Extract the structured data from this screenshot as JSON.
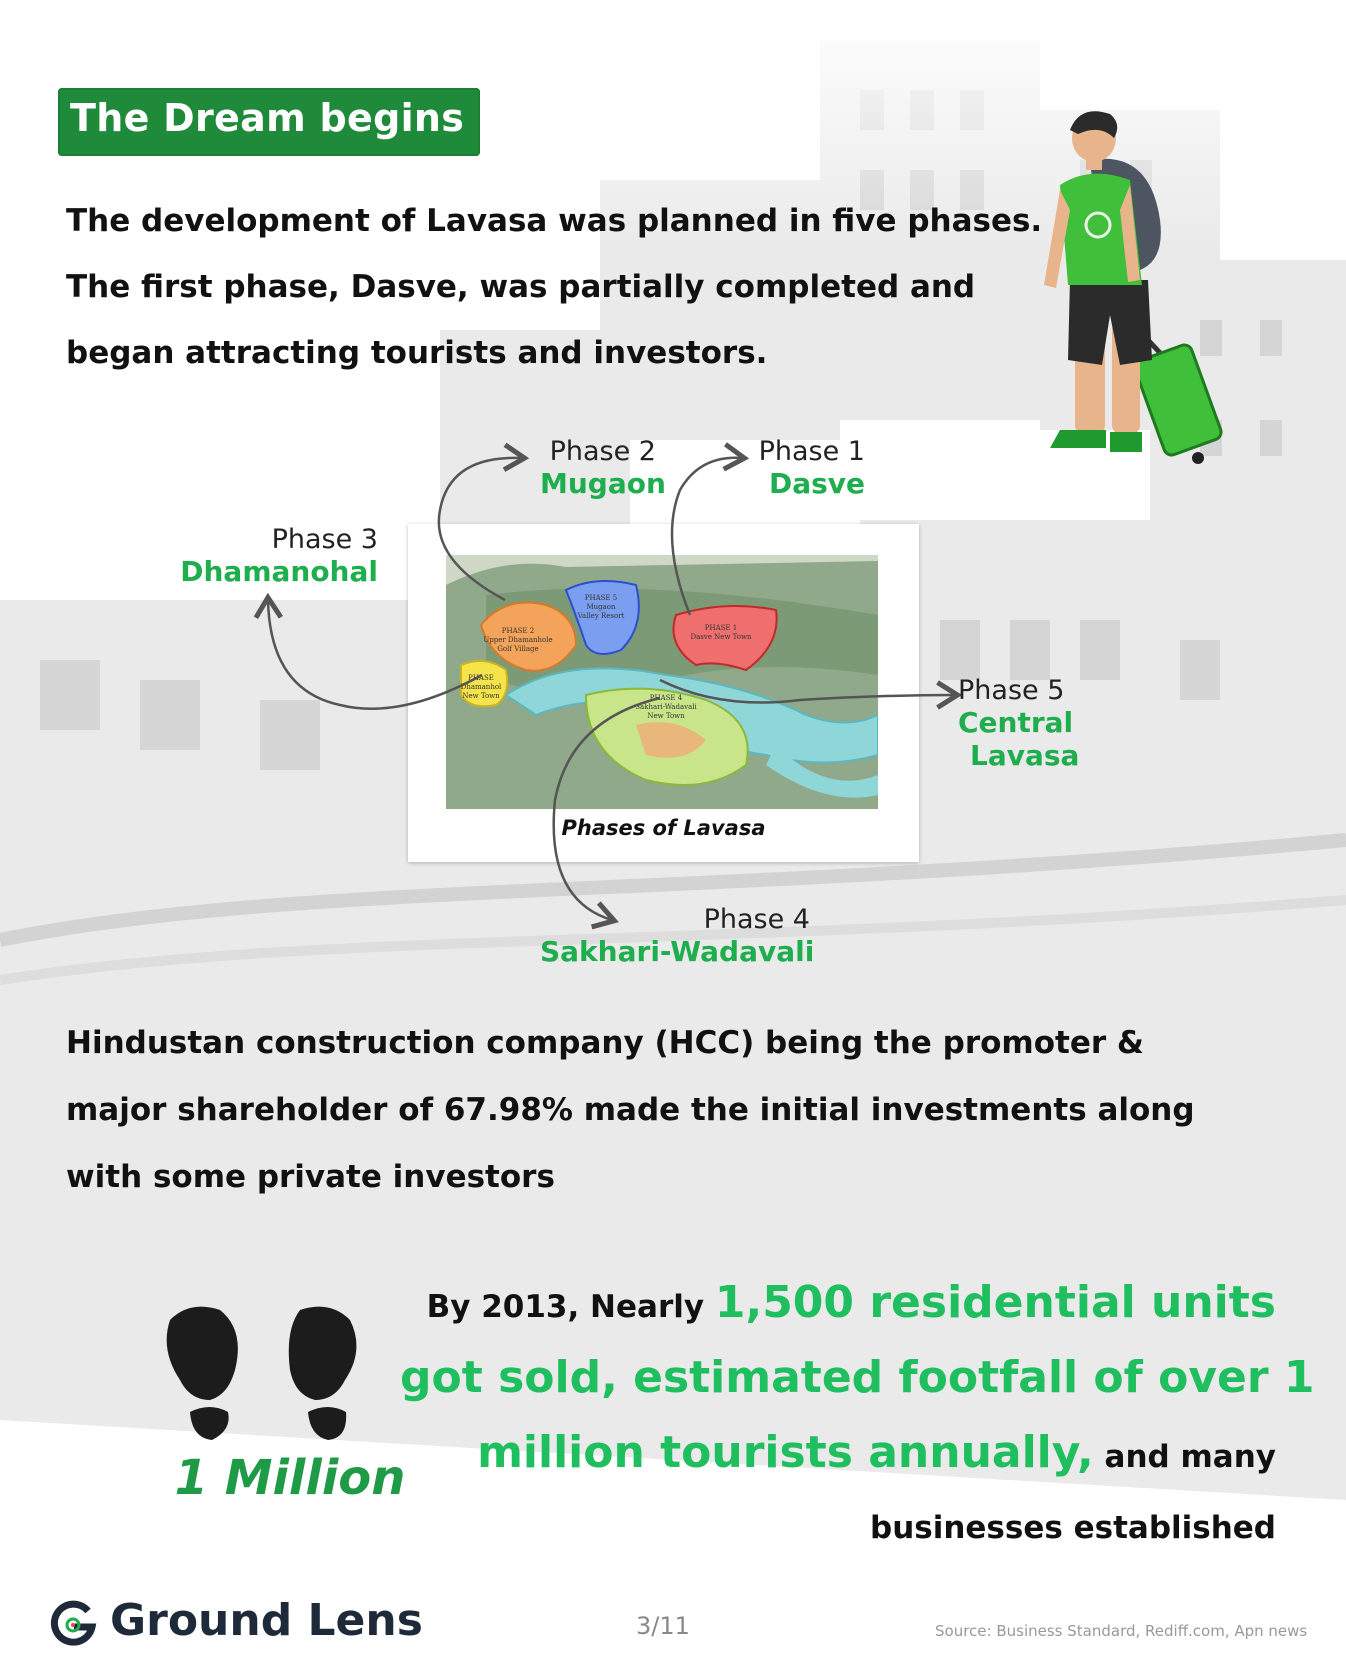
{
  "header": {
    "title": "The Dream begins"
  },
  "intro": {
    "lines": [
      "The development of Lavasa was planned in five phases.",
      "The first phase, Dasve, was partially completed and",
      "began attracting tourists and investors."
    ]
  },
  "map": {
    "caption": "Phases of Lavasa",
    "phases": [
      {
        "label": "Phase 1",
        "name": "Dasve"
      },
      {
        "label": "Phase 2",
        "name": "Mugaon"
      },
      {
        "label": "Phase 3",
        "name": "Dhamanohal"
      },
      {
        "label": "Phase 4",
        "name": "Sakhari-Wadavali"
      },
      {
        "label": "Phase 5",
        "name_line1": "Central",
        "name_line2": "Lavasa"
      }
    ],
    "inner_labels": [
      "PHASE 2",
      "Upper Dhamanhole",
      "Golf Village",
      "PHASE 5",
      "Mugaon",
      "Valley Resort",
      "PHASE 1",
      "Dasve New Town",
      "PHASE",
      "Dhamanhol",
      "New Town",
      "PHASE 4",
      "Sakhari-Wadavali",
      "New Town"
    ]
  },
  "hcc": {
    "lines": [
      "Hindustan construction company (HCC) being the promoter &",
      "major shareholder of 67.98% made the initial investments along",
      "with some private investors"
    ]
  },
  "stats": {
    "line1_small": "By 2013, Nearly ",
    "line1_green": "1,500 residential units",
    "line2_green": "got sold, estimated footfall of over 1",
    "line3_green": "million tourists annually,",
    "line3_small": " and many",
    "line4_small": "businesses established",
    "highlight": "1 Million"
  },
  "footer": {
    "brand": "Ground Lens",
    "page": "3/11",
    "source": "Source: Business Standard, Rediff.com, Apn news"
  },
  "colors": {
    "brand_green": "#1f8a3a",
    "accent_green": "#1fbe5e",
    "text_dark": "#111111"
  },
  "icons": [
    "traveler-illustration",
    "footprints-icon",
    "ground-lens-logo-icon",
    "arrow-icon"
  ]
}
